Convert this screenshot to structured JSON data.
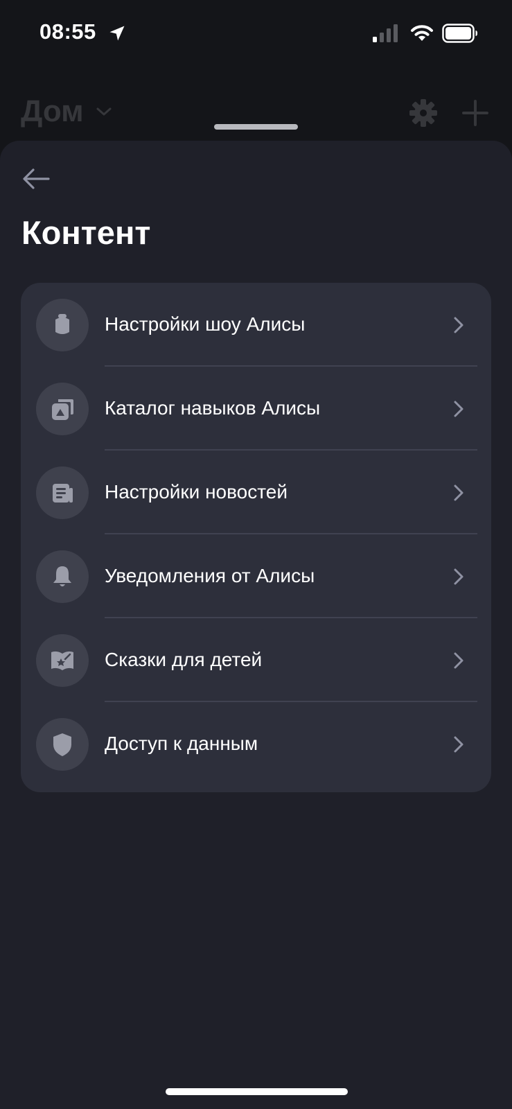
{
  "status_bar": {
    "time": "08:55"
  },
  "background_header": {
    "title": "Дом"
  },
  "sheet": {
    "title": "Контент"
  },
  "menu": {
    "items": [
      {
        "label": "Настройки шоу Алисы",
        "icon": "speaker-icon"
      },
      {
        "label": "Каталог навыков Алисы",
        "icon": "skills-catalog-icon"
      },
      {
        "label": "Настройки новостей",
        "icon": "news-icon"
      },
      {
        "label": "Уведомления от Алисы",
        "icon": "bell-icon"
      },
      {
        "label": "Сказки для детей",
        "icon": "storybook-icon"
      },
      {
        "label": "Доступ к данным",
        "icon": "shield-icon"
      }
    ]
  },
  "colors": {
    "background": "#141519",
    "sheet": "#1f2029",
    "card": "#2d2f3b",
    "icon_circle": "#3f414d",
    "icon_glyph": "#9b9da9",
    "chevron": "#8f92a3"
  }
}
